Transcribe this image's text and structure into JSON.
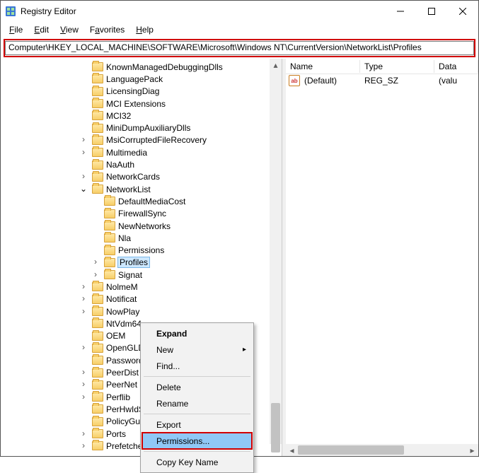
{
  "window": {
    "title": "Registry Editor"
  },
  "menu": {
    "file": "File",
    "edit": "Edit",
    "view": "View",
    "favorites": "Favorites",
    "help": "Help"
  },
  "address": {
    "path": "Computer\\HKEY_LOCAL_MACHINE\\SOFTWARE\\Microsoft\\Windows NT\\CurrentVersion\\NetworkList\\Profiles"
  },
  "tree": {
    "items": [
      {
        "indent": 7,
        "exp": "",
        "label": "KnownManagedDebuggingDlls"
      },
      {
        "indent": 7,
        "exp": "",
        "label": "LanguagePack"
      },
      {
        "indent": 7,
        "exp": "",
        "label": "LicensingDiag"
      },
      {
        "indent": 7,
        "exp": "",
        "label": "MCI Extensions"
      },
      {
        "indent": 7,
        "exp": "",
        "label": "MCI32"
      },
      {
        "indent": 7,
        "exp": "",
        "label": "MiniDumpAuxiliaryDlls"
      },
      {
        "indent": 7,
        "exp": ">",
        "label": "MsiCorruptedFileRecovery"
      },
      {
        "indent": 7,
        "exp": ">",
        "label": "Multimedia"
      },
      {
        "indent": 7,
        "exp": "",
        "label": "NaAuth"
      },
      {
        "indent": 7,
        "exp": ">",
        "label": "NetworkCards"
      },
      {
        "indent": 7,
        "exp": "v",
        "label": "NetworkList"
      },
      {
        "indent": 8,
        "exp": "",
        "label": "DefaultMediaCost"
      },
      {
        "indent": 8,
        "exp": "",
        "label": "FirewallSync"
      },
      {
        "indent": 8,
        "exp": "",
        "label": "NewNetworks"
      },
      {
        "indent": 8,
        "exp": "",
        "label": "Nla"
      },
      {
        "indent": 8,
        "exp": "",
        "label": "Permissions"
      },
      {
        "indent": 8,
        "exp": ">",
        "label": "Profiles",
        "selected": true
      },
      {
        "indent": 8,
        "exp": ">",
        "label": "Signat"
      },
      {
        "indent": 7,
        "exp": ">",
        "label": "NolmeM"
      },
      {
        "indent": 7,
        "exp": ">",
        "label": "Notificat"
      },
      {
        "indent": 7,
        "exp": ">",
        "label": "NowPlay"
      },
      {
        "indent": 7,
        "exp": "",
        "label": "NtVdm64"
      },
      {
        "indent": 7,
        "exp": "",
        "label": "OEM"
      },
      {
        "indent": 7,
        "exp": ">",
        "label": "OpenGLD"
      },
      {
        "indent": 7,
        "exp": "",
        "label": "Password"
      },
      {
        "indent": 7,
        "exp": ">",
        "label": "PeerDist"
      },
      {
        "indent": 7,
        "exp": ">",
        "label": "PeerNet"
      },
      {
        "indent": 7,
        "exp": ">",
        "label": "Perflib"
      },
      {
        "indent": 7,
        "exp": "",
        "label": "PerHwIdStorage"
      },
      {
        "indent": 7,
        "exp": "",
        "label": "PolicyGuid"
      },
      {
        "indent": 7,
        "exp": ">",
        "label": "Ports"
      },
      {
        "indent": 7,
        "exp": ">",
        "label": "Prefetcher"
      }
    ]
  },
  "list": {
    "columns": {
      "name": "Name",
      "type": "Type",
      "data": "Data"
    },
    "rows": [
      {
        "name": "(Default)",
        "type": "REG_SZ",
        "data": "(valu"
      }
    ]
  },
  "context": {
    "expand": "Expand",
    "new": "New",
    "find": "Find...",
    "delete": "Delete",
    "rename": "Rename",
    "export": "Export",
    "permissions": "Permissions...",
    "copykey": "Copy Key Name"
  }
}
